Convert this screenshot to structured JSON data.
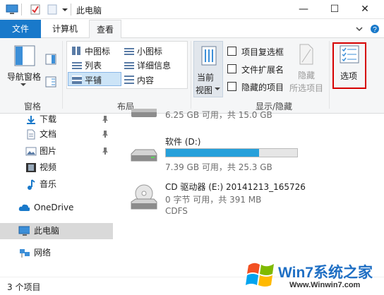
{
  "window": {
    "title": "此电脑",
    "minimize_icon": "minimize-icon",
    "maximize_icon": "maximize-icon",
    "close_icon": "close-icon"
  },
  "tabs": [
    {
      "label": "文件"
    },
    {
      "label": "计算机"
    },
    {
      "label": "查看"
    }
  ],
  "ribbon": {
    "panes": {
      "nav_pane_label": "导航窗格",
      "group_label": "窗格"
    },
    "layout": {
      "group_label": "布局",
      "items": [
        {
          "label": "中图标"
        },
        {
          "label": "小图标"
        },
        {
          "label": "列表"
        },
        {
          "label": "详细信息"
        },
        {
          "label": "平铺"
        },
        {
          "label": "内容"
        }
      ],
      "selected": "平铺"
    },
    "current_view": {
      "label_line1": "当前",
      "label_line2": "视图"
    },
    "show_hide": {
      "group_label": "显示/隐藏",
      "checkboxes": [
        {
          "label": "项目复选框",
          "checked": false
        },
        {
          "label": "文件扩展名",
          "checked": false
        },
        {
          "label": "隐藏的项目",
          "checked": false
        }
      ],
      "hide_selected_line1": "隐藏",
      "hide_selected_line2": "所选项目"
    },
    "options": {
      "label": "选项"
    }
  },
  "nav": {
    "items": [
      {
        "label": "下载",
        "icon": "download-icon",
        "pinned": true
      },
      {
        "label": "文档",
        "icon": "document-icon",
        "pinned": true
      },
      {
        "label": "图片",
        "icon": "picture-icon",
        "pinned": true
      },
      {
        "label": "视频",
        "icon": "video-icon",
        "pinned": false
      },
      {
        "label": "音乐",
        "icon": "music-icon",
        "pinned": false
      },
      {
        "label": "OneDrive",
        "icon": "cloud-icon",
        "pinned": false
      },
      {
        "label": "此电脑",
        "icon": "computer-icon",
        "pinned": false,
        "selected": true
      },
      {
        "label": "网络",
        "icon": "network-icon",
        "pinned": false
      }
    ]
  },
  "content": {
    "drives": [
      {
        "name": "",
        "space": "6.25 GB 可用，共 15.0 GB",
        "used_fraction": null
      },
      {
        "name": "软件 (D:)",
        "space": "7.39 GB 可用，共 25.3 GB",
        "used_fraction": 0.71
      },
      {
        "name": "CD 驱动器 (E:) 20141213_165726",
        "space": "0 字节 可用，共 391 MB",
        "fs": "CDFS"
      }
    ]
  },
  "status": {
    "count": "3 个项目"
  },
  "watermark": {
    "brand": "Win7系统之家",
    "url": "Www.Winwin7.com"
  },
  "colors": {
    "file_tab": "#1979ca",
    "highlight_box": "#d60000",
    "progress_fill": "#26a0da"
  }
}
